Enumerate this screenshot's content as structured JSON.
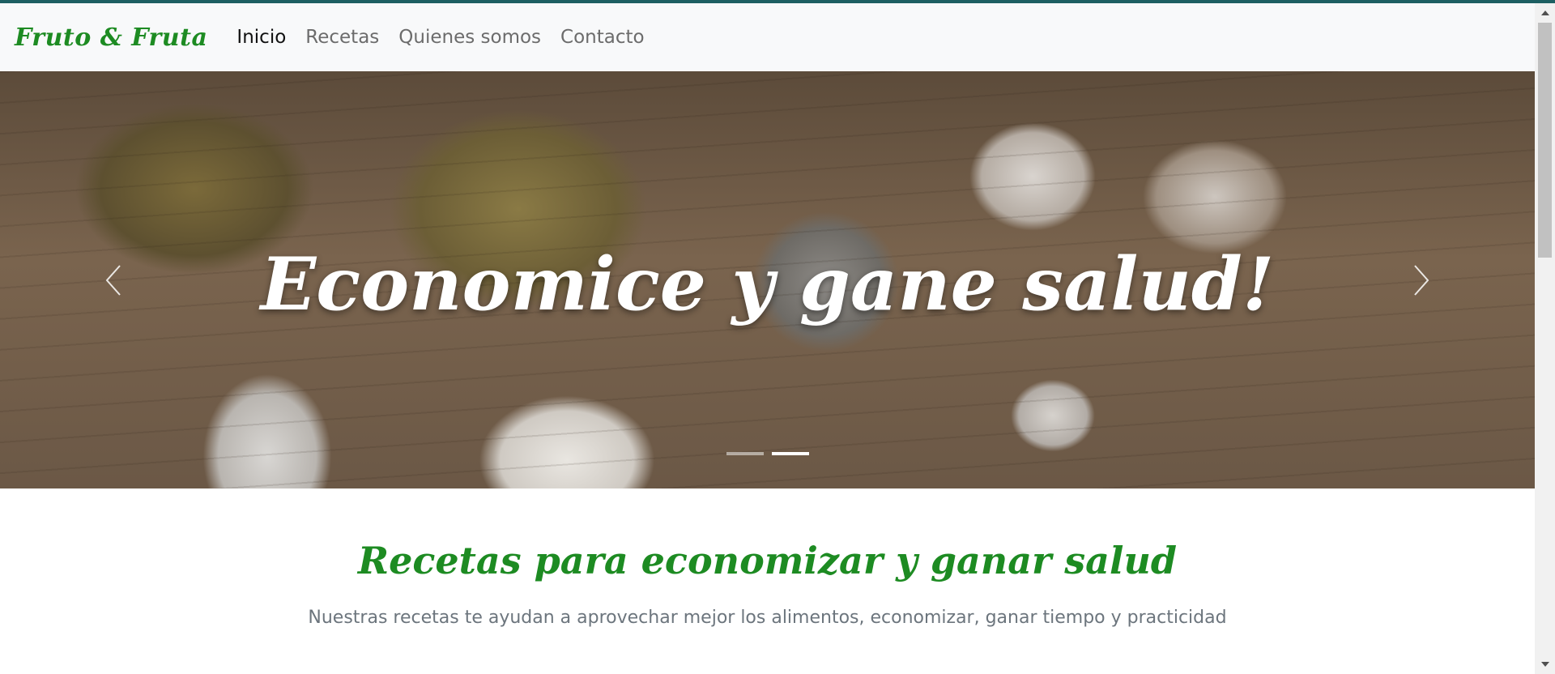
{
  "navbar": {
    "brand": "Fruto & Fruta",
    "links": [
      {
        "label": "Inicio",
        "active": true
      },
      {
        "label": "Recetas",
        "active": false
      },
      {
        "label": "Quienes somos",
        "active": false
      },
      {
        "label": "Contacto",
        "active": false
      }
    ]
  },
  "carousel": {
    "caption": "Economice y gane salud!",
    "prev_icon": "chevron-left-icon",
    "next_icon": "chevron-right-icon",
    "slide_count": 2,
    "active_index": 1
  },
  "section": {
    "title": "Recetas para economizar y ganar salud",
    "subtitle": "Nuestras recetas te ayudan a aprovechar mejor los alimentos, economizar, ganar tiempo y practicidad"
  },
  "colors": {
    "brand_green": "#1d8b22",
    "top_accent": "#1d5f62",
    "navbar_bg": "#f8f9fa"
  }
}
